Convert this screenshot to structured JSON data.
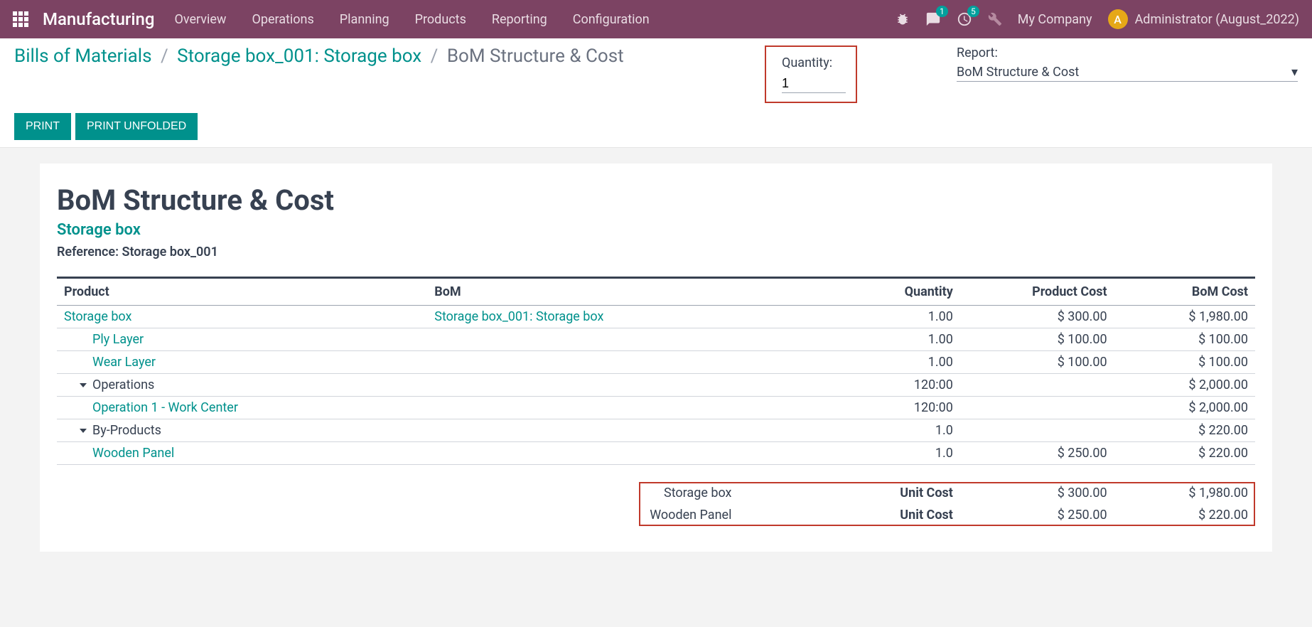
{
  "navbar": {
    "brand": "Manufacturing",
    "items": [
      "Overview",
      "Operations",
      "Planning",
      "Products",
      "Reporting",
      "Configuration"
    ],
    "messages_badge": "1",
    "activities_badge": "5",
    "company": "My Company",
    "avatar_initial": "A",
    "user": "Administrator (August_2022)"
  },
  "breadcrumb": {
    "a": "Bills of Materials",
    "b": "Storage box_001: Storage box",
    "c": "BoM Structure & Cost"
  },
  "quantity": {
    "label": "Quantity:",
    "value": "1"
  },
  "report": {
    "label": "Report:",
    "value": "BoM Structure & Cost"
  },
  "buttons": {
    "print": "PRINT",
    "print_unfolded": "PRINT UNFOLDED"
  },
  "header": {
    "title": "BoM Structure & Cost",
    "subtitle": "Storage box",
    "reference": "Reference: Storage box_001"
  },
  "columns": {
    "product": "Product",
    "bom": "BoM",
    "quantity": "Quantity",
    "product_cost": "Product Cost",
    "bom_cost": "BoM Cost"
  },
  "rows": [
    {
      "product": "Storage box",
      "bom": "Storage box_001: Storage box",
      "quantity": "1.00",
      "product_cost": "$ 300.00",
      "bom_cost": "$ 1,980.00",
      "link": true,
      "indent": 0
    },
    {
      "product": "Ply Layer",
      "bom": "",
      "quantity": "1.00",
      "product_cost": "$ 100.00",
      "bom_cost": "$ 100.00",
      "link": true,
      "indent": 1
    },
    {
      "product": "Wear Layer",
      "bom": "",
      "quantity": "1.00",
      "product_cost": "$ 100.00",
      "bom_cost": "$ 100.00",
      "link": true,
      "indent": 1
    },
    {
      "product": "Operations",
      "bom": "",
      "quantity": "120:00",
      "product_cost": "",
      "bom_cost": "$ 2,000.00",
      "link": false,
      "caret": true
    },
    {
      "product": "Operation 1 - Work Center",
      "bom": "",
      "quantity": "120:00",
      "product_cost": "",
      "bom_cost": "$ 2,000.00",
      "link": true,
      "indent": 1
    },
    {
      "product": "By-Products",
      "bom": "",
      "quantity": "1.0",
      "product_cost": "",
      "bom_cost": "$ 220.00",
      "link": false,
      "caret": true
    },
    {
      "product": "Wooden Panel",
      "bom": "",
      "quantity": "1.0",
      "product_cost": "$ 250.00",
      "bom_cost": "$ 220.00",
      "link": true,
      "indent": 1
    }
  ],
  "summary": [
    {
      "product": "Storage box",
      "label": "Unit Cost",
      "product_cost": "$ 300.00",
      "bom_cost": "$ 1,980.00"
    },
    {
      "product": "Wooden Panel",
      "label": "Unit Cost",
      "product_cost": "$ 250.00",
      "bom_cost": "$ 220.00"
    }
  ]
}
